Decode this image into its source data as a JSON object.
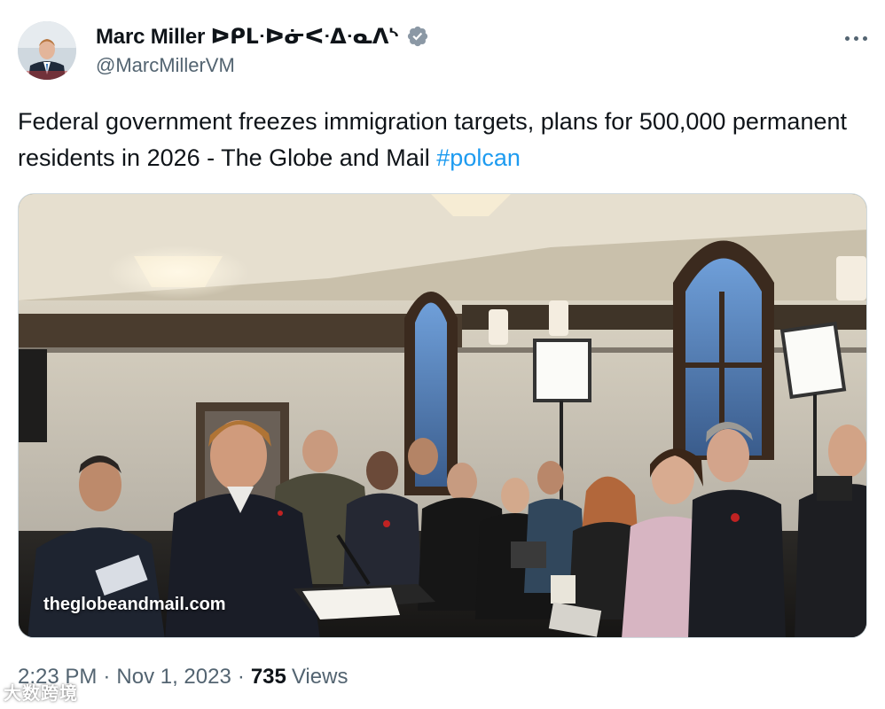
{
  "author": {
    "display_name": "Marc Miller ᐅᑭᒪᐧᐅᓃᐸᐧᐃᐧᓇᐱᔅ",
    "handle": "@MarcMillerVM",
    "verified_icon": "verified-badge-icon",
    "verified_color": "#8b98a5"
  },
  "tweet": {
    "text": "Federal government freezes immigration targets, plans for 500,000 permanent residents in 2026 - The Globe and Mail ",
    "hashtag": "#polcan",
    "link_color": "#1d9bf0"
  },
  "media": {
    "source_label": "theglobeandmail.com"
  },
  "meta": {
    "time": "2:23 PM",
    "separator": "·",
    "date": "Nov 1, 2023",
    "views_count": "735",
    "views_label": "Views"
  },
  "watermark": {
    "text": "大数跨境"
  },
  "icons": {
    "more": "more-dots-icon"
  }
}
